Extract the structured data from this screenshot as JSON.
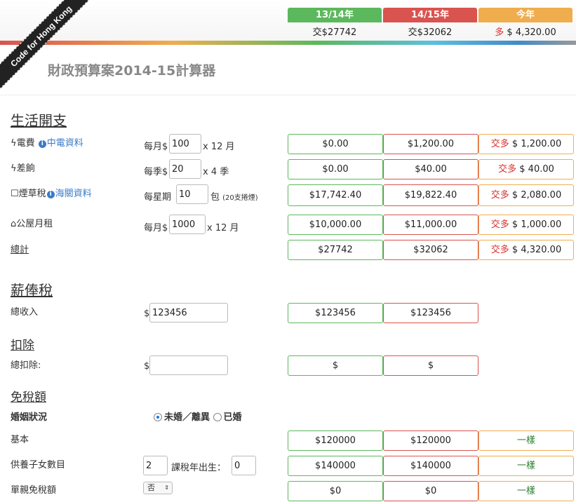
{
  "banner": "Code for Hong Kong",
  "columns": {
    "c1": {
      "label": "13/14年",
      "sub": "交$27742",
      "color": "#5cb85c"
    },
    "c2": {
      "label": "14/15年",
      "sub": "交$32062",
      "color": "#d9534f"
    },
    "c3": {
      "label": "今年",
      "sub_prefix": "多",
      "sub_value": "$ 4,320.00",
      "color": "#f0ad4e"
    }
  },
  "title": "財政預算案2014-15計算器",
  "living": {
    "heading": "生活開支",
    "electricity": {
      "label": "電費",
      "link": "中電資料",
      "prefix": "每月$",
      "value": "100",
      "suffix": "x 12 月",
      "c1": "$0.00",
      "c2": "$1,200.00",
      "c3_prefix": "交多",
      "c3": "$ 1,200.00"
    },
    "rates": {
      "label": "差餉",
      "prefix": "每季$",
      "value": "20",
      "suffix": "x 4 季",
      "c1": "$0.00",
      "c2": "$40.00",
      "c3_prefix": "交多",
      "c3": "$ 40.00"
    },
    "tobacco": {
      "label": "煙草稅",
      "link": "海關資料",
      "prefix": "每星期",
      "value": "10",
      "suffix": "包",
      "note": "(20支捲煙)",
      "c1": "$17,742.40",
      "c2": "$19,822.40",
      "c3_prefix": "交多",
      "c3": "$ 2,080.00"
    },
    "rent": {
      "label": "公屋月租",
      "prefix": "每月$",
      "value": "1000",
      "suffix": "x 12 月",
      "c1": "$10,000.00",
      "c2": "$11,000.00",
      "c3_prefix": "交多",
      "c3": "$ 1,000.00"
    },
    "total": {
      "label": "總計",
      "c1": "$27742",
      "c2": "$32062",
      "c3_prefix": "交多",
      "c3": "$ 4,320.00"
    }
  },
  "salary": {
    "heading": "薪俸稅",
    "income": {
      "label": "總收入",
      "prefix": "$",
      "value": "123456",
      "c1": "$123456",
      "c2": "$123456"
    }
  },
  "deduction": {
    "heading": "扣除",
    "total": {
      "label": "總扣除:",
      "prefix": "$",
      "value": "",
      "c1": "$",
      "c2": "$"
    }
  },
  "allowance": {
    "heading": "免稅額",
    "marital": {
      "label": "婚姻狀況",
      "opt1": "未婚／離異",
      "opt2": "已婚"
    },
    "basic": {
      "label": "基本",
      "c1": "$120000",
      "c2": "$120000",
      "c3": "一樣"
    },
    "children": {
      "label": "供養子女數目",
      "value": "2",
      "born_label": "課稅年出生：",
      "born_value": "0",
      "c1": "$140000",
      "c2": "$140000",
      "c3": "一樣"
    },
    "single_parent": {
      "label": "單親免稅額",
      "select": "否",
      "c1": "$0",
      "c2": "$0",
      "c3": "一樣"
    }
  }
}
